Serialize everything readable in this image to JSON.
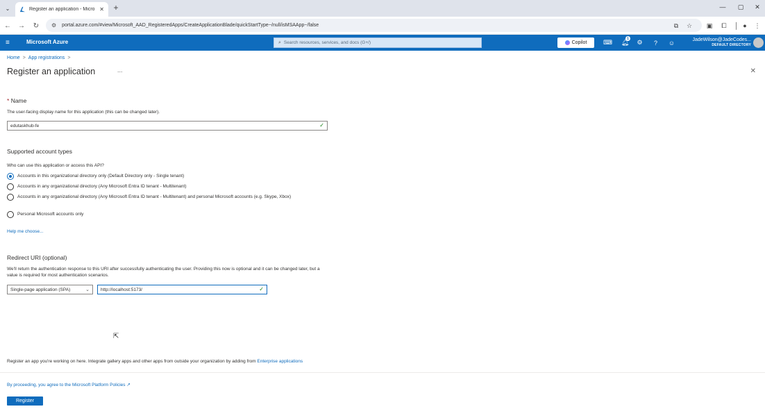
{
  "browser": {
    "tab_title": "Register an application - Micro",
    "url_host": "portal.azure.com",
    "url": "portal.azure.com/#view/Microsoft_AAD_RegisteredApps/CreateApplicationBlade/quickStartType~/null/isMSAApp~/false"
  },
  "header": {
    "brand": "Microsoft Azure",
    "search_placeholder": "Search resources, services, and docs (G+/)",
    "copilot_label": "Copilot",
    "notification_count": "1",
    "user_name": "JadeWilson@JadeCodes...",
    "directory": "DEFAULT DIRECTORY"
  },
  "breadcrumb": {
    "home": "Home",
    "app_registrations": "App registrations"
  },
  "page": {
    "title": "Register an application",
    "more": "..."
  },
  "name_section": {
    "required_mark": "*",
    "label": "Name",
    "description": "The user-facing display name for this application (this can be changed later).",
    "value": "edutaskhub-fe"
  },
  "account_types": {
    "heading": "Supported account types",
    "question": "Who can use this application or access this API?",
    "options": [
      {
        "label": "Accounts in this organizational directory only (Default Directory only - Single tenant)",
        "selected": true
      },
      {
        "label": "Accounts in any organizational directory (Any Microsoft Entra ID tenant - Multitenant)",
        "selected": false
      },
      {
        "label": "Accounts in any organizational directory (Any Microsoft Entra ID tenant - Multitenant) and personal Microsoft accounts (e.g. Skype, Xbox)",
        "selected": false
      },
      {
        "label": "Personal Microsoft accounts only",
        "selected": false
      }
    ],
    "help_link": "Help me choose..."
  },
  "redirect": {
    "heading": "Redirect URI (optional)",
    "description": "We'll return the authentication response to this URI after successfully authenticating the user. Providing this now is optional and it can be changed later, but a value is required for most authentication scenarios.",
    "platform": "Single-page application (SPA)",
    "uri": "http://localhost:5173/"
  },
  "footer": {
    "note": "Register an app you're working on here. Integrate gallery apps and other apps from outside your organization by adding from",
    "note_link": "Enterprise applications",
    "policy": "By proceeding, you agree to the Microsoft Platform Policies",
    "register_label": "Register"
  },
  "colors": {
    "azure_blue": "#0f6cbd",
    "required_red": "#a4262c",
    "valid_green": "#107c10"
  }
}
